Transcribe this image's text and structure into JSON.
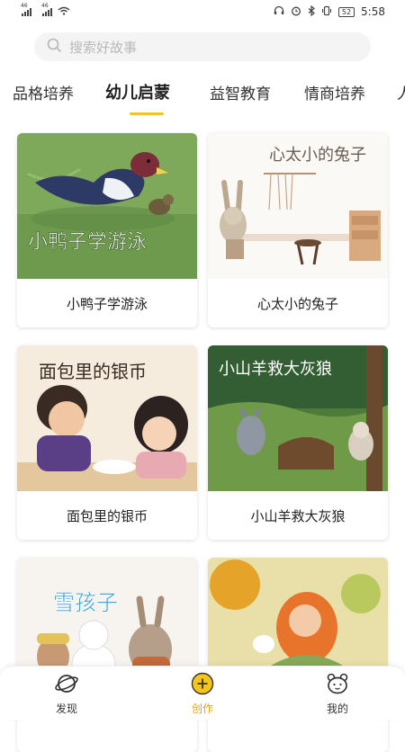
{
  "status_bar": {
    "signal_1": "46",
    "signal_2": "46",
    "battery": "52",
    "time": "5:58"
  },
  "search": {
    "placeholder": "搜索好故事"
  },
  "tabs": [
    {
      "label": "品格培养",
      "active": false
    },
    {
      "label": "幼儿启蒙",
      "active": true
    },
    {
      "label": "益智教育",
      "active": false
    },
    {
      "label": "情商培养",
      "active": false
    },
    {
      "label": "人",
      "active": false
    }
  ],
  "cards": [
    {
      "title": "小鸭子学游泳",
      "cover_text": "小鸭子学游泳"
    },
    {
      "title": "心太小的兔子",
      "cover_text": "心太小的兔子"
    },
    {
      "title": "面包里的银币",
      "cover_text": "面包里的银币"
    },
    {
      "title": "小山羊救大灰狼",
      "cover_text": "小山羊救大灰狼"
    },
    {
      "title": "",
      "cover_text": "雪孩子"
    },
    {
      "title": "",
      "cover_text": ""
    }
  ],
  "bottom_nav": [
    {
      "label": "发现",
      "icon": "planet-icon"
    },
    {
      "label": "创作",
      "icon": "plus-circle-icon",
      "active": true
    },
    {
      "label": "我的",
      "icon": "bear-face-icon"
    }
  ],
  "colors": {
    "accent": "#f5c518",
    "accent_text": "#e0a800"
  }
}
